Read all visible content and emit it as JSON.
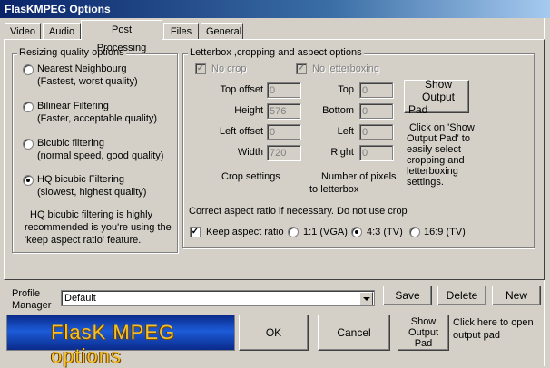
{
  "window": {
    "title": "FlasKMPEG Options"
  },
  "tabs": [
    {
      "label": "Video"
    },
    {
      "label": "Audio"
    },
    {
      "label": "Post Processing"
    },
    {
      "label": "Files"
    },
    {
      "label": "General"
    }
  ],
  "resize": {
    "group_label": "Resizing quality options",
    "options": [
      {
        "title": "Nearest Neighbourg",
        "desc": "(Fastest, worst quality)",
        "selected": false
      },
      {
        "title": "Bilinear Filtering",
        "desc": "(Faster, acceptable quality)",
        "selected": false
      },
      {
        "title": "Bicubic filtering",
        "desc": "(normal speed, good quality)",
        "selected": false
      },
      {
        "title": "HQ bicubic Filtering",
        "desc": "(slowest, highest quality)",
        "selected": true
      }
    ],
    "note_line1": "HQ bicubic filtering is highly",
    "note_line2": "recommended is you're using the",
    "note_line3": "'keep aspect ratio' feature."
  },
  "letterbox": {
    "group_label": "Letterbox ,cropping and aspect options",
    "no_crop_label": "No crop",
    "no_letterbox_label": "No letterboxing",
    "crop": {
      "top_offset_label": "Top offset",
      "top_offset_value": "0",
      "height_label": "Height",
      "height_value": "576",
      "left_offset_label": "Left offset",
      "left_offset_value": "0",
      "width_label": "Width",
      "width_value": "720",
      "caption": "Crop settings"
    },
    "pad": {
      "top_label": "Top",
      "top_value": "0",
      "bottom_label": "Bottom",
      "bottom_value": "0",
      "left_label": "Left",
      "left_value": "0",
      "right_label": "Right",
      "right_value": "0",
      "caption_line1": "Number of pixels",
      "caption_line2": "to letterbox"
    },
    "show_pad_button_line1": "Show Output",
    "show_pad_button_line2": "Pad",
    "pad_hint_lines": [
      "Click on 'Show",
      "Output Pad' to",
      "easily select",
      "cropping and",
      "letterboxing",
      "settings."
    ],
    "aspect_note": "Correct aspect ratio if necessary. Do not use crop",
    "keep_aspect_label": "Keep aspect ratio",
    "aspect_options": [
      {
        "label": "1:1 (VGA)",
        "selected": false
      },
      {
        "label": "4:3 (TV)",
        "selected": true
      },
      {
        "label": "16:9 (TV)",
        "selected": false
      }
    ]
  },
  "profile": {
    "label_line1": "Profile",
    "label_line2": "Manager",
    "selected": "Default",
    "save_label": "Save",
    "delete_label": "Delete",
    "new_label": "New"
  },
  "footer": {
    "banner_text": "FlasK MPEG options",
    "ok_label": "OK",
    "cancel_label": "Cancel",
    "show_pad_line1": "Show",
    "show_pad_line2": "Output",
    "show_pad_line3": "Pad",
    "hint_line1": "Click here to open",
    "hint_line2": "output pad"
  }
}
